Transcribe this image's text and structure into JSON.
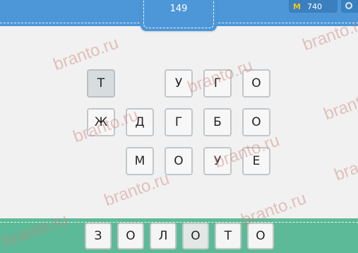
{
  "header": {
    "level": "149",
    "coins": "740",
    "coin_symbol": "M"
  },
  "grid": {
    "tiles": [
      "Т",
      "У",
      "Г",
      "О",
      "Ж",
      "Д",
      "Г",
      "Б",
      "О",
      "М",
      "О",
      "У",
      "Е"
    ],
    "used": [
      0
    ]
  },
  "answer": {
    "letters": [
      "З",
      "О",
      "Л",
      "О",
      "Т",
      "О"
    ]
  },
  "watermark": "branto.ru",
  "colors": {
    "top_bar": "#4d97d8",
    "bottom_bar": "#5dba98",
    "background": "#f1f1f1",
    "coin": "#f5c518"
  }
}
